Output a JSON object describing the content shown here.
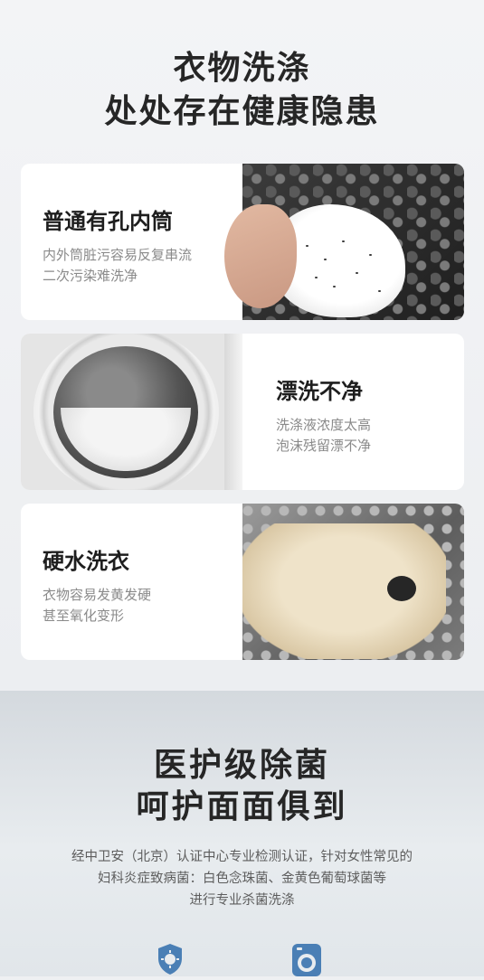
{
  "header": {
    "line1": "衣物洗涤",
    "line2": "处处存在健康隐患"
  },
  "cards": [
    {
      "title": "普通有孔内筒",
      "desc1": "内外筒脏污容易反复串流",
      "desc2": "二次污染难洗净"
    },
    {
      "title": "漂洗不净",
      "desc1": "洗涤液浓度太高",
      "desc2": "泡沫残留漂不净"
    },
    {
      "title": "硬水洗衣",
      "desc1": "衣物容易发黄发硬",
      "desc2": "甚至氧化变形"
    }
  ],
  "section2": {
    "line1": "医护级除菌",
    "line2": "呵护面面俱到",
    "body1": "经中卫安（北京）认证中心专业检测认证，针对女性常见的",
    "body2": "妇科炎症致病菌：白色念珠菌、金黄色葡萄球菌等",
    "body3": "进行专业杀菌洗涤"
  },
  "icons": [
    "virus-shield-icon",
    "washing-machine-icon"
  ],
  "colors": {
    "accent_blue": "#4a7fb5"
  }
}
